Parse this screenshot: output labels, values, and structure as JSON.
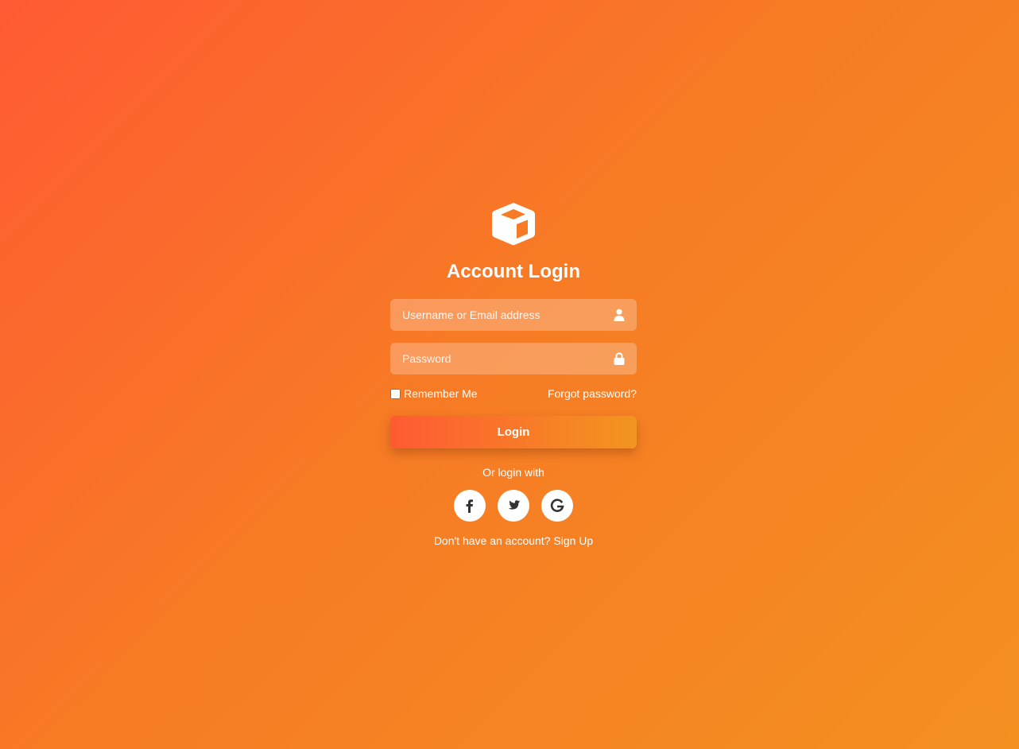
{
  "logo": {
    "icon": "cube-icon",
    "color": "#ffffff"
  },
  "title": "Account Login",
  "fields": {
    "username": {
      "placeholder": "Username or Email address",
      "value": "",
      "icon": "user-icon"
    },
    "password": {
      "placeholder": "Password",
      "value": "",
      "icon": "lock-icon"
    }
  },
  "options": {
    "remember_label": "Remember Me",
    "remember_checked": false,
    "forgot_label": "Forgot password?"
  },
  "login_button": {
    "label": "Login"
  },
  "social": {
    "heading": "Or login with",
    "providers": [
      {
        "name": "facebook",
        "icon": "facebook-icon"
      },
      {
        "name": "twitter",
        "icon": "twitter-icon"
      },
      {
        "name": "google",
        "icon": "google-icon"
      }
    ]
  },
  "signup": {
    "prompt": "Don't have an account?",
    "link_label": "Sign Up"
  },
  "colors": {
    "bg_start": "#ff5a33",
    "bg_end": "#f39020",
    "button_start": "#ff5a33",
    "button_end": "#f2951f",
    "social_icon": "#333333"
  }
}
